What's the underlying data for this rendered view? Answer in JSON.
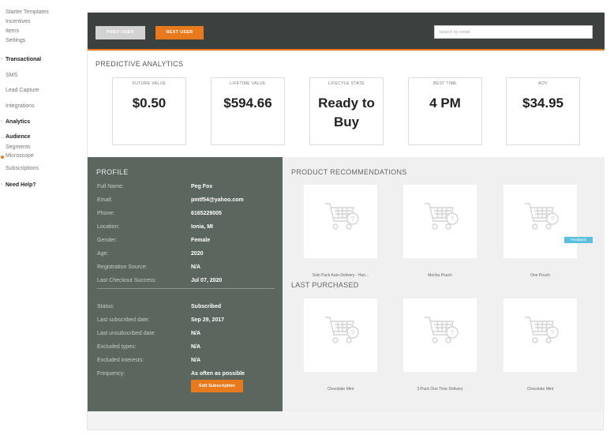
{
  "sidebar": {
    "starter_templates": "Starter Templates",
    "incentives": "Incentives",
    "items": "Items",
    "settings": "Settings",
    "transactional": "Transactional",
    "sms": "SMS",
    "lead_capture": "Lead Capture",
    "integrations": "Integrations",
    "analytics": "Analytics",
    "audience": "Audience",
    "segments": "Segments",
    "microscope": "Microscope",
    "subscriptions": "Subscriptions",
    "need_help": "Need Help?"
  },
  "toolbar": {
    "prev_label": "PREV USER",
    "next_label": "NEXT USER",
    "search_placeholder": "Search by email"
  },
  "predictive": {
    "title": "PREDICTIVE ANALYTICS",
    "cards": [
      {
        "label": "FUTURE VALUE",
        "value": "$0.50"
      },
      {
        "label": "LIFETIME VALUE",
        "value": "$594.66"
      },
      {
        "label": "LIFECYLE STATE",
        "value": "Ready to Buy"
      },
      {
        "label": "BEST TIME",
        "value": "4 PM"
      },
      {
        "label": "AOV",
        "value": "$34.95"
      }
    ]
  },
  "profile": {
    "title": "PROFILE",
    "rows": [
      {
        "label": "Full Name:",
        "value": "Peg Fox"
      },
      {
        "label": "Email:",
        "value": "pmtf54@yahoo.com"
      },
      {
        "label": "Phone:",
        "value": "6165229005"
      },
      {
        "label": "Location:",
        "value": "Ionia, MI"
      },
      {
        "label": "Gender:",
        "value": "Female"
      },
      {
        "label": "Age:",
        "value": "2020"
      },
      {
        "label": "Registration Source:",
        "value": "N/A"
      },
      {
        "label": "Last Checkout Success:",
        "value": "Jul 07, 2020"
      }
    ],
    "sub_rows": [
      {
        "label": "Status:",
        "value": "Subscribed"
      },
      {
        "label": "Last subscribed date:",
        "value": "Sep 29, 2017"
      },
      {
        "label": "Last unsubscribed date:",
        "value": "N/A"
      },
      {
        "label": "Excluded types:",
        "value": "N/A"
      },
      {
        "label": "Excluded interests:",
        "value": "N/A"
      },
      {
        "label": "Frequency:",
        "value": "As often as possible"
      }
    ],
    "edit_label": "Edit Subscription"
  },
  "recommendations": {
    "title": "PRODUCT RECOMMENDATIONS",
    "items": [
      "Solo Pack Auto-Delivery - Hun...",
      "Mocha Pouch",
      "One Pouch"
    ]
  },
  "last_purchased": {
    "title": "LAST PURCHASED",
    "items": [
      "Chocolate Mint",
      "3-Pack One Time Delivery",
      "Chocolate Mint"
    ]
  },
  "feedback_label": "Feedback",
  "colors": {
    "accent": "#e8791d",
    "topbar": "#3b413f",
    "profile_bg": "#5b665e",
    "feedback": "#5bc0de"
  }
}
